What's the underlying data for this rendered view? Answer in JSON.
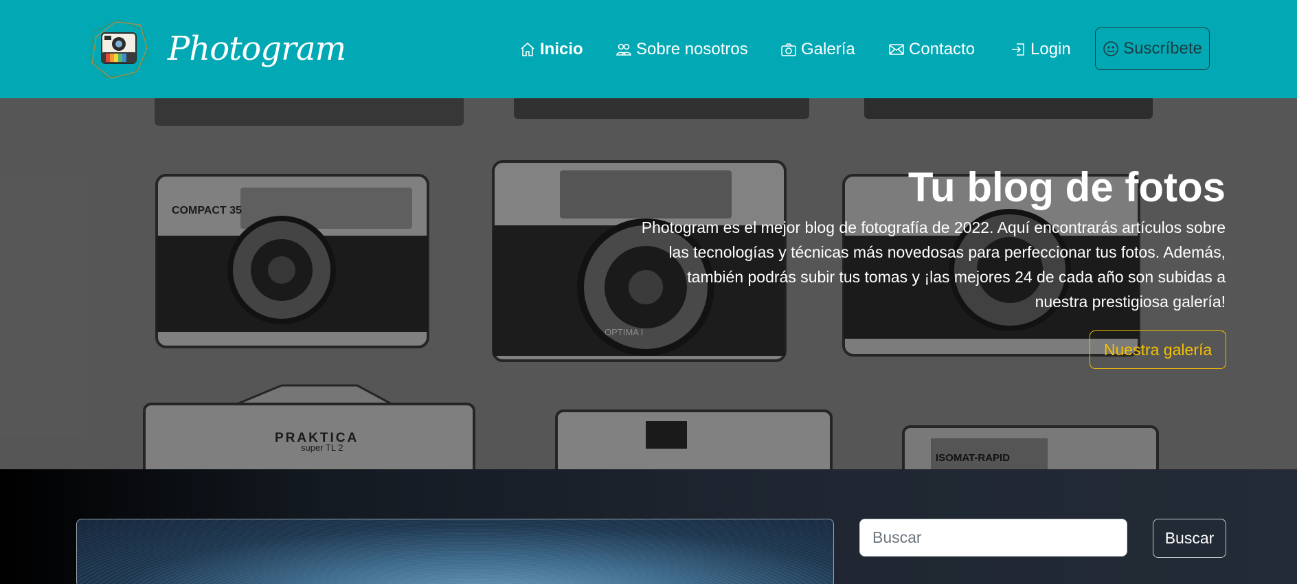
{
  "navbar": {
    "brand": "Photogram",
    "logo_icon": "polaroid-camera-icon",
    "items": [
      {
        "label": "Inicio",
        "icon": "home-icon",
        "active": true
      },
      {
        "label": "Sobre nosotros",
        "icon": "people-icon",
        "active": false
      },
      {
        "label": "Galería",
        "icon": "camera-icon",
        "active": false
      },
      {
        "label": "Contacto",
        "icon": "envelope-icon",
        "active": false
      },
      {
        "label": "Login",
        "icon": "login-icon",
        "active": false
      }
    ],
    "subscribe": {
      "label": "Suscríbete",
      "icon": "smile-icon"
    }
  },
  "hero": {
    "title": "Tu blog de fotos",
    "text": "Photogram es el mejor blog de fotografía de 2022. Aquí encontrarás artículos sobre las tecnologías y técnicas más novedosas para perfeccionar tus fotos. Además, también podrás subir tus tomas y ¡las mejores 24 de cada año son subidas a nuestra prestigiosa galería!",
    "button_label": "Nuestra galería",
    "camera_labels": [
      "COMPACT 35",
      "PRAKTICA",
      "super TL 2",
      "ISOMAT-RAPID",
      "OPTIMA I"
    ]
  },
  "search": {
    "placeholder": "Buscar",
    "value": "",
    "button_label": "Buscar"
  },
  "colors": {
    "navbar_bg": "#02a9b5",
    "accent_yellow": "#f5c000",
    "dark_text": "#1c3b40"
  }
}
